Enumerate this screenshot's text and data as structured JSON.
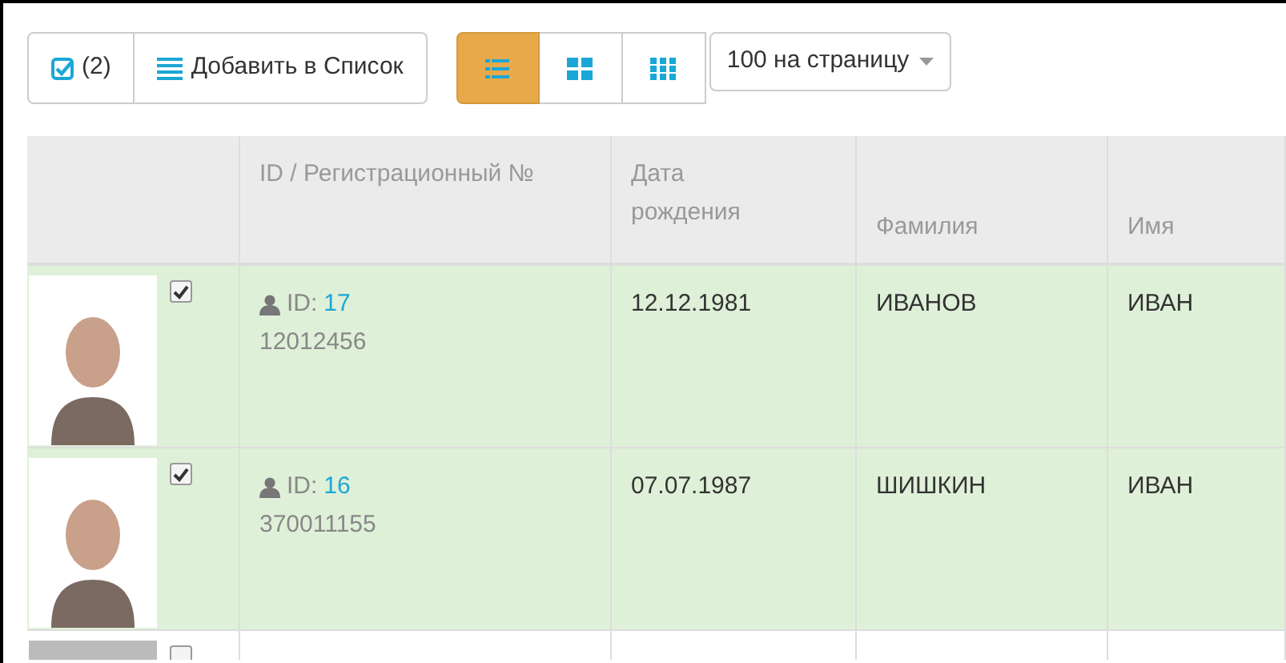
{
  "toolbar": {
    "selected_count": "(2)",
    "add_to_list": "Добавить в Список",
    "views": [
      {
        "kind": "list",
        "selected": true
      },
      {
        "kind": "large-grid",
        "selected": false
      },
      {
        "kind": "small-grid",
        "selected": false
      }
    ],
    "per_page": "100 на страницу"
  },
  "table": {
    "columns": [
      "ID / Регистрационный №",
      "Дата рождения",
      "Фамилия",
      "Имя"
    ],
    "rows": [
      {
        "checked": true,
        "id_label": "ID:",
        "id": "17",
        "reg_number": "12012456",
        "birth_date": "12.12.1981",
        "last_name": "ИВАНОВ",
        "first_name": "ИВАН"
      },
      {
        "checked": true,
        "id_label": "ID:",
        "id": "16",
        "reg_number": "370011155",
        "birth_date": "07.07.1987",
        "last_name": "ШИШКИН",
        "first_name": "ИВАН"
      },
      {
        "checked": false
      }
    ]
  }
}
